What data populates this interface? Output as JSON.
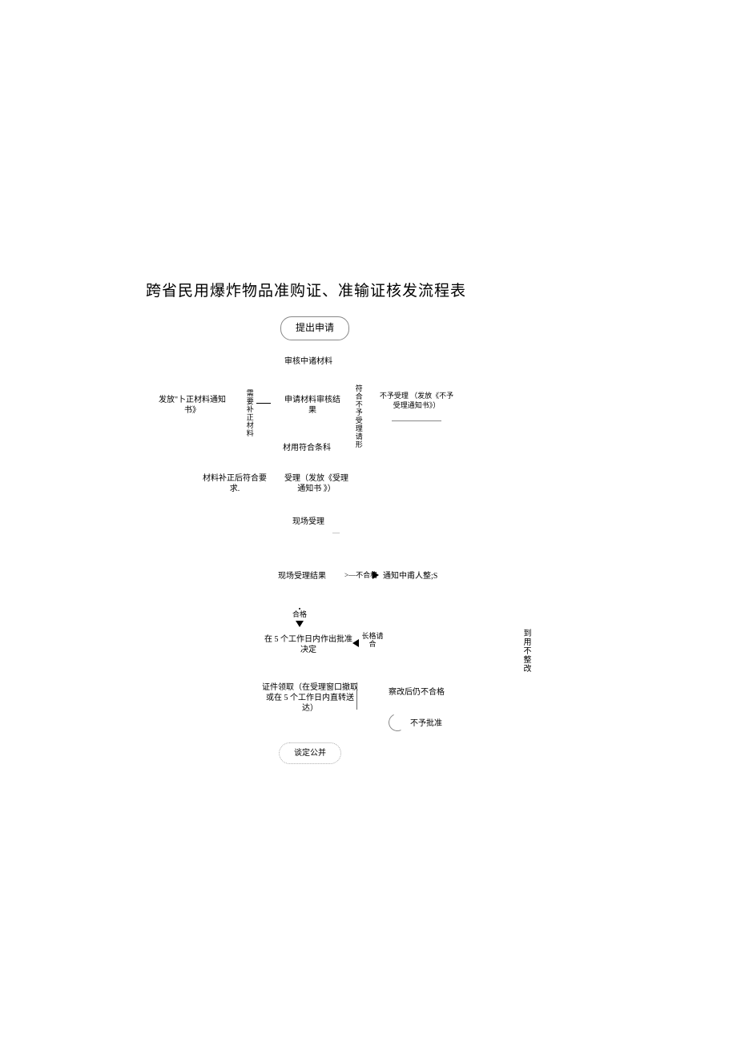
{
  "title": "跨省民用爆炸物品准购证、准输证核发流程表",
  "nodes": {
    "start": "提出申请",
    "review_materials": "审核中诸材料",
    "need_supplement": "需要补正材料",
    "issue_correction": "发放\"卜正材料通知书》",
    "material_review": "申请材料审核结果",
    "not_accept_case": "符合不予受理请形",
    "not_accept": "不予受理 （发放《不予受理通知书》）",
    "material_ok": "材用符合条科",
    "after_correction": "材料补正后符合要求.",
    "accept": "受理（发放《受理通知书 》）",
    "onsite_accept": "现场受理",
    "onsite_result": "现场受理结果",
    "fail": "不合格",
    "notify_rectify": "通知中甫人整;S",
    "pass": "合格",
    "decision": "在 5 个工作日内作出批准决定",
    "qualified_request": "长格请合",
    "cert_collect": "证件领取（在受理窗口撤取或在 5 个工作日内直转送达）",
    "still_fail": "察改后仍不合格",
    "not_approve": "不予批准",
    "refuse_rectify": "到用不整改",
    "publish": "谈定公并"
  }
}
